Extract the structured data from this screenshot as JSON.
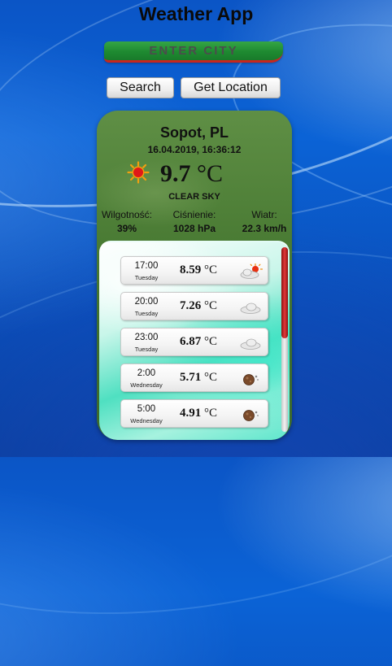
{
  "app": {
    "title": "Weather App"
  },
  "search": {
    "placeholder": "ENTER CITY",
    "search_label": "Search",
    "location_label": "Get Location"
  },
  "current": {
    "city": "Sopot, PL",
    "datetime": "16.04.2019, 16:36:12",
    "temp_value": "9.7",
    "unit": "°C",
    "condition": "CLEAR SKY",
    "icon": "sun-icon",
    "humidity": {
      "label": "Wilgotność:",
      "value": "39%"
    },
    "pressure": {
      "label": "Ciśnienie:",
      "value": "1028 hPa"
    },
    "wind": {
      "label": "Wiatr:",
      "value": "22.3 km/h"
    }
  },
  "forecast": [
    {
      "time": "17:00",
      "day": "Tuesday",
      "temp": "8.59",
      "unit": "°C",
      "icon": "partly-sunny-icon"
    },
    {
      "time": "20:00",
      "day": "Tuesday",
      "temp": "7.26",
      "unit": "°C",
      "icon": "cloud-icon"
    },
    {
      "time": "23:00",
      "day": "Tuesday",
      "temp": "6.87",
      "unit": "°C",
      "icon": "cloud-icon"
    },
    {
      "time": "2:00",
      "day": "Wednesday",
      "temp": "5.71",
      "unit": "°C",
      "icon": "moon-icon"
    },
    {
      "time": "5:00",
      "day": "Wednesday",
      "temp": "4.91",
      "unit": "°C",
      "icon": "moon-icon"
    }
  ],
  "colors": {
    "input_bg": "#2a9a3c",
    "input_underline": "#c8261f",
    "card_bg": "#4a7b34",
    "forecast_accent": "#4fe0c1",
    "scroll_thumb": "#c82a2a"
  }
}
